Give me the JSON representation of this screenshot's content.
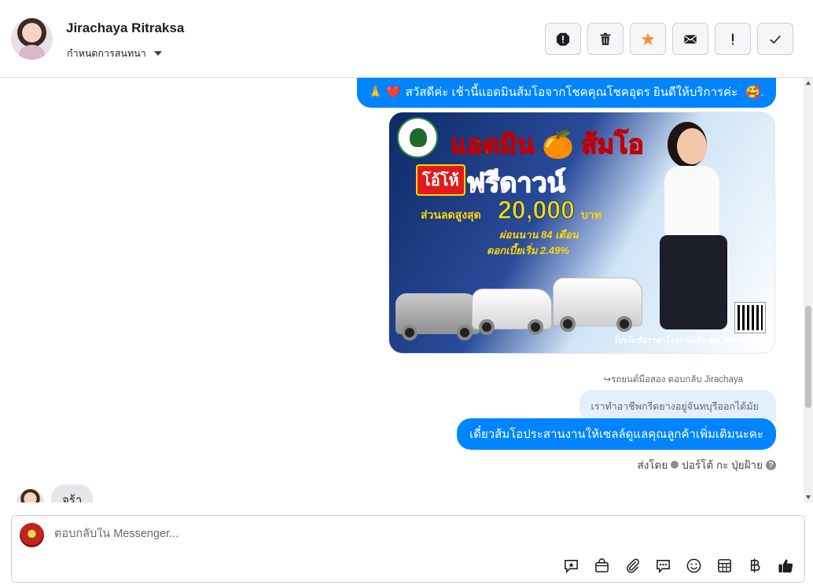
{
  "header": {
    "contact_name": "Jirachaya Ritraksa",
    "assign_label": "กำหนดการสนทนา",
    "actions": [
      {
        "name": "report-spam-button",
        "icon": "alert-octagon-icon"
      },
      {
        "name": "delete-button",
        "icon": "trash-icon"
      },
      {
        "name": "star-button",
        "icon": "star-icon"
      },
      {
        "name": "mark-unread-button",
        "icon": "envelope-icon"
      },
      {
        "name": "follow-up-button",
        "icon": "exclamation-icon"
      },
      {
        "name": "mark-done-button",
        "icon": "checkmark-icon"
      }
    ]
  },
  "thread": {
    "greeting_emoji_left": "🙏",
    "greeting_heart": "❤️",
    "greeting_text": "สวัสดีค่ะ เช้านี้แอดมินส้มโอจากโชคคุณโชคอุดร ยินดีให้บริการค่ะ",
    "greeting_emoji_right": "🥰.",
    "promo": {
      "title": "แอดมิน 🍊 ส้มโอ",
      "badge": "โอ้โห้",
      "headline": "ฟรีดาวน์",
      "discount_label": "ส่วนลดสูงสุด",
      "discount_amount": "20,000",
      "discount_unit": "บาท",
      "installment": "ผ่อนนาน 84 เดือน",
      "interest": "ดอกเบี้ยเริ่ม 2.49%",
      "footer": "โปรโมชั่นราคาโรงงานผลิต คุณได้รถที่ถูกกว่า"
    },
    "reply_meta": "↪รถยนต์มือสอง ตอบกลับ Jirachaya",
    "quoted_text": "เราทำอาชีพกรีดยางอยู่จันทบุรีออกได้มัย",
    "reply_text": "เดี๋ยวส้มโอประสานงานให้เซลล์ดูแลคุณลูกค้าเพิ่มเติมนะคะ",
    "sent_by_prefix": "ส่งโดย",
    "sent_by_name": "ปอร์โต้ กะ ปุ่ยฝ้าย",
    "incoming_text": "จร้า"
  },
  "composer": {
    "placeholder": "ตอบกลับใน Messenger...",
    "tools": [
      "saved-reply-icon",
      "shop-bag-icon",
      "paperclip-icon",
      "chat-bubbles-icon",
      "smiley-icon",
      "table-grid-icon",
      "baht-icon",
      "thumbs-up-icon"
    ]
  },
  "colors": {
    "accent": "#0084ff",
    "star": "#f7923a",
    "incoming_bubble": "#e4e6eb",
    "quoted_bubble": "#e4effc"
  }
}
